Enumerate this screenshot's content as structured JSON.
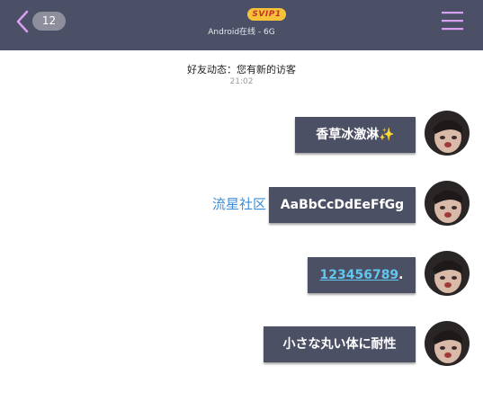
{
  "header": {
    "unread_count": "12",
    "svip_label": "SVIP1",
    "status": "Android在线 - 6G"
  },
  "system_message": {
    "text": "好友动态：您有新的访客",
    "time": "21:02"
  },
  "messages": [
    {
      "text": "香草冰激淋",
      "emoji": "✨"
    },
    {
      "text": "AaBbCcDdEeFfGg",
      "tag": "流星社区"
    },
    {
      "link_text": "123456789",
      "suffix": "."
    },
    {
      "text": "小さな丸い体に耐性"
    }
  ],
  "colors": {
    "header_bg": "#4b5066",
    "bubble_bg": "#4c5064",
    "menu_accent": "#d8a0f0",
    "link": "#62c6ee",
    "tag": "#3d8ed6"
  }
}
